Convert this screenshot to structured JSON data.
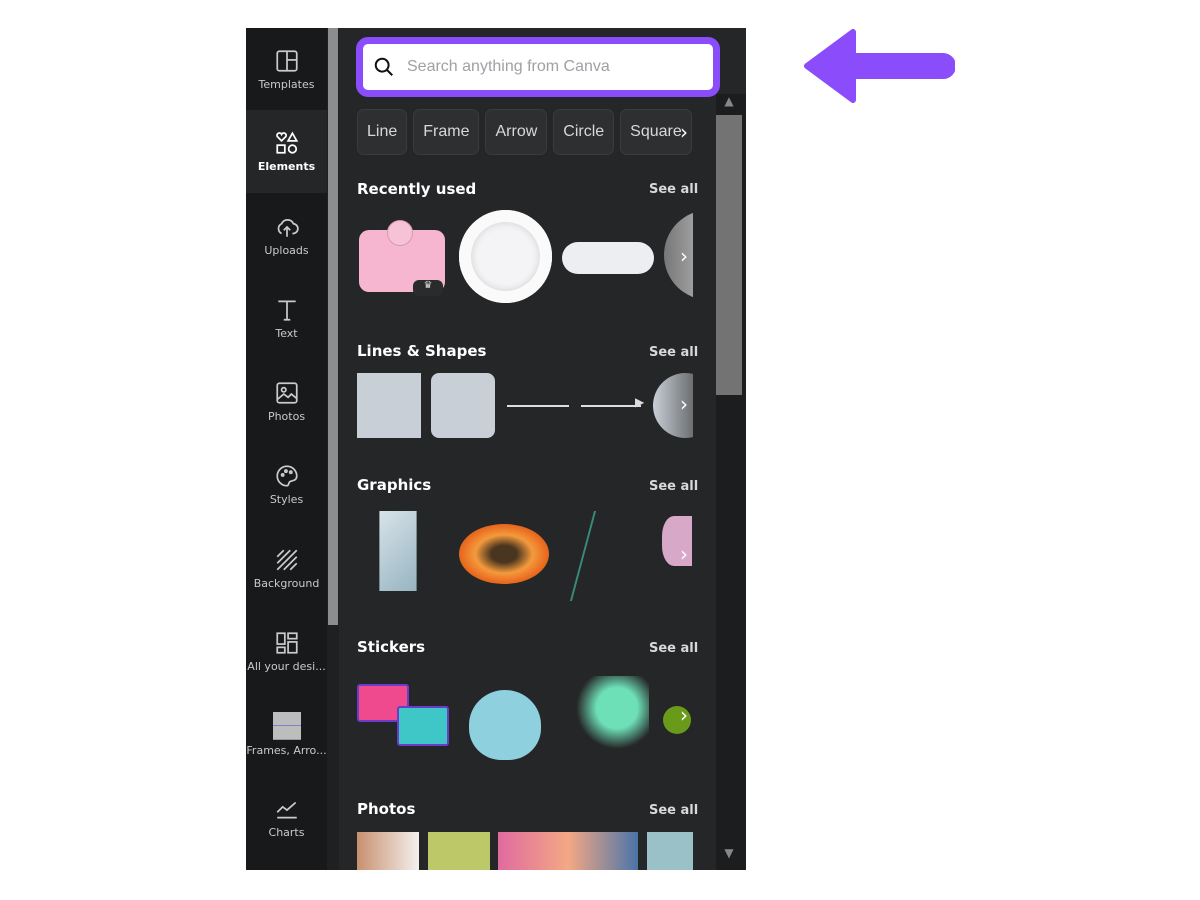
{
  "sidebar": {
    "items": [
      {
        "label": "Templates",
        "icon": "layout-icon"
      },
      {
        "label": "Elements",
        "icon": "shapes-icon",
        "active": true
      },
      {
        "label": "Uploads",
        "icon": "cloud-upload-icon"
      },
      {
        "label": "Text",
        "icon": "text-icon"
      },
      {
        "label": "Photos",
        "icon": "image-icon"
      },
      {
        "label": "Styles",
        "icon": "palette-icon"
      },
      {
        "label": "Background",
        "icon": "stripes-icon"
      },
      {
        "label": "All your desi...",
        "icon": "grid-icon"
      },
      {
        "label": "Frames, Arro...",
        "icon": "frame-thumbnail-icon"
      },
      {
        "label": "Charts",
        "icon": "chart-icon"
      }
    ]
  },
  "search": {
    "placeholder": "Search anything from Canva",
    "accent": "#8b4dfb"
  },
  "chips": [
    "Line",
    "Frame",
    "Arrow",
    "Circle",
    "Square"
  ],
  "sections": [
    {
      "title": "Recently used",
      "see_all": "See all"
    },
    {
      "title": "Lines & Shapes",
      "see_all": "See all"
    },
    {
      "title": "Graphics",
      "see_all": "See all"
    },
    {
      "title": "Stickers",
      "see_all": "See all"
    },
    {
      "title": "Photos",
      "see_all": "See all"
    }
  ],
  "annotation": {
    "arrow_color": "#8b4dfb",
    "direction": "left"
  }
}
